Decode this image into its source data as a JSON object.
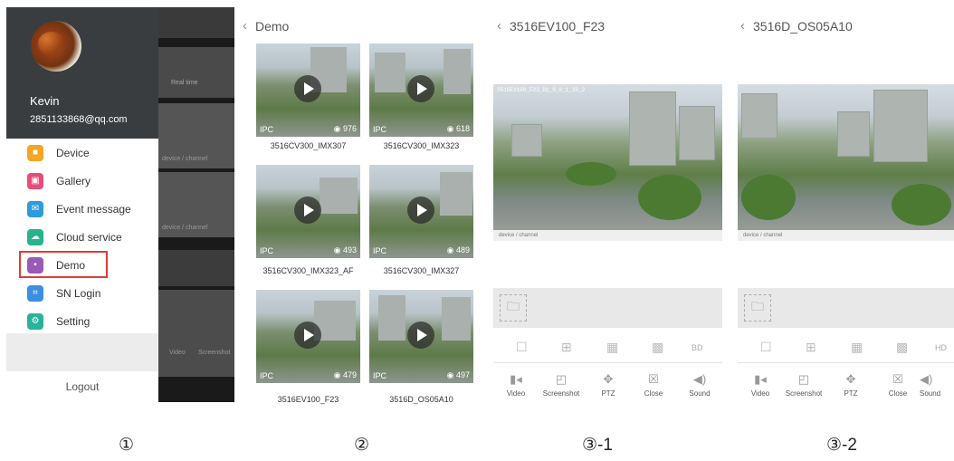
{
  "drawer": {
    "user_name": "Kevin",
    "user_email": "2851133868@qq.com",
    "items": [
      {
        "label": "Device",
        "icon": "device-icon",
        "color": "#f5a623"
      },
      {
        "label": "Gallery",
        "icon": "gallery-icon",
        "color": "#e84c7a"
      },
      {
        "label": "Event message",
        "icon": "message-icon",
        "color": "#2d9cdb"
      },
      {
        "label": "Cloud service",
        "icon": "cloud-icon",
        "color": "#27b38b"
      },
      {
        "label": "Demo",
        "icon": "demo-icon",
        "color": "#9b59b6"
      },
      {
        "label": "SN Login",
        "icon": "sn-login-icon",
        "color": "#3d8fe0"
      },
      {
        "label": "Setting",
        "icon": "setting-icon",
        "color": "#2bb29a"
      }
    ],
    "logout": "Logout",
    "behind": {
      "real_time": "Real time",
      "channel": "device / channel",
      "video": "Video",
      "screenshot": "Screenshot"
    }
  },
  "demo_list": {
    "title": "Demo",
    "items": [
      {
        "name": "3516CV300_IMX307",
        "tag": "IPC",
        "views": "976"
      },
      {
        "name": "3516CV300_IMX323",
        "tag": "IPC",
        "views": "618"
      },
      {
        "name": "3516CV300_IMX323_AF",
        "tag": "IPC",
        "views": "493"
      },
      {
        "name": "3516CV300_IMX327",
        "tag": "IPC",
        "views": "489"
      },
      {
        "name": "3516EV100_F23",
        "tag": "IPC",
        "views": "479"
      },
      {
        "name": "3516D_OS05A10",
        "tag": "IPC",
        "views": "497"
      }
    ]
  },
  "player1": {
    "title": "3516EV100_F23",
    "osd": "3516EV100_F23_D1_9_0_1_35_2",
    "channel": "device / channel",
    "quality": "BD",
    "tools": [
      "Video",
      "Screenshot",
      "PTZ",
      "Close",
      "Sound"
    ]
  },
  "player2": {
    "title": "3516D_OS05A10",
    "channel": "device / channel",
    "quality": "HD",
    "tools": [
      "Video",
      "Screenshot",
      "PTZ",
      "Close",
      "Sound"
    ]
  },
  "steps": [
    "①",
    "②",
    "③-1",
    "③-2"
  ]
}
